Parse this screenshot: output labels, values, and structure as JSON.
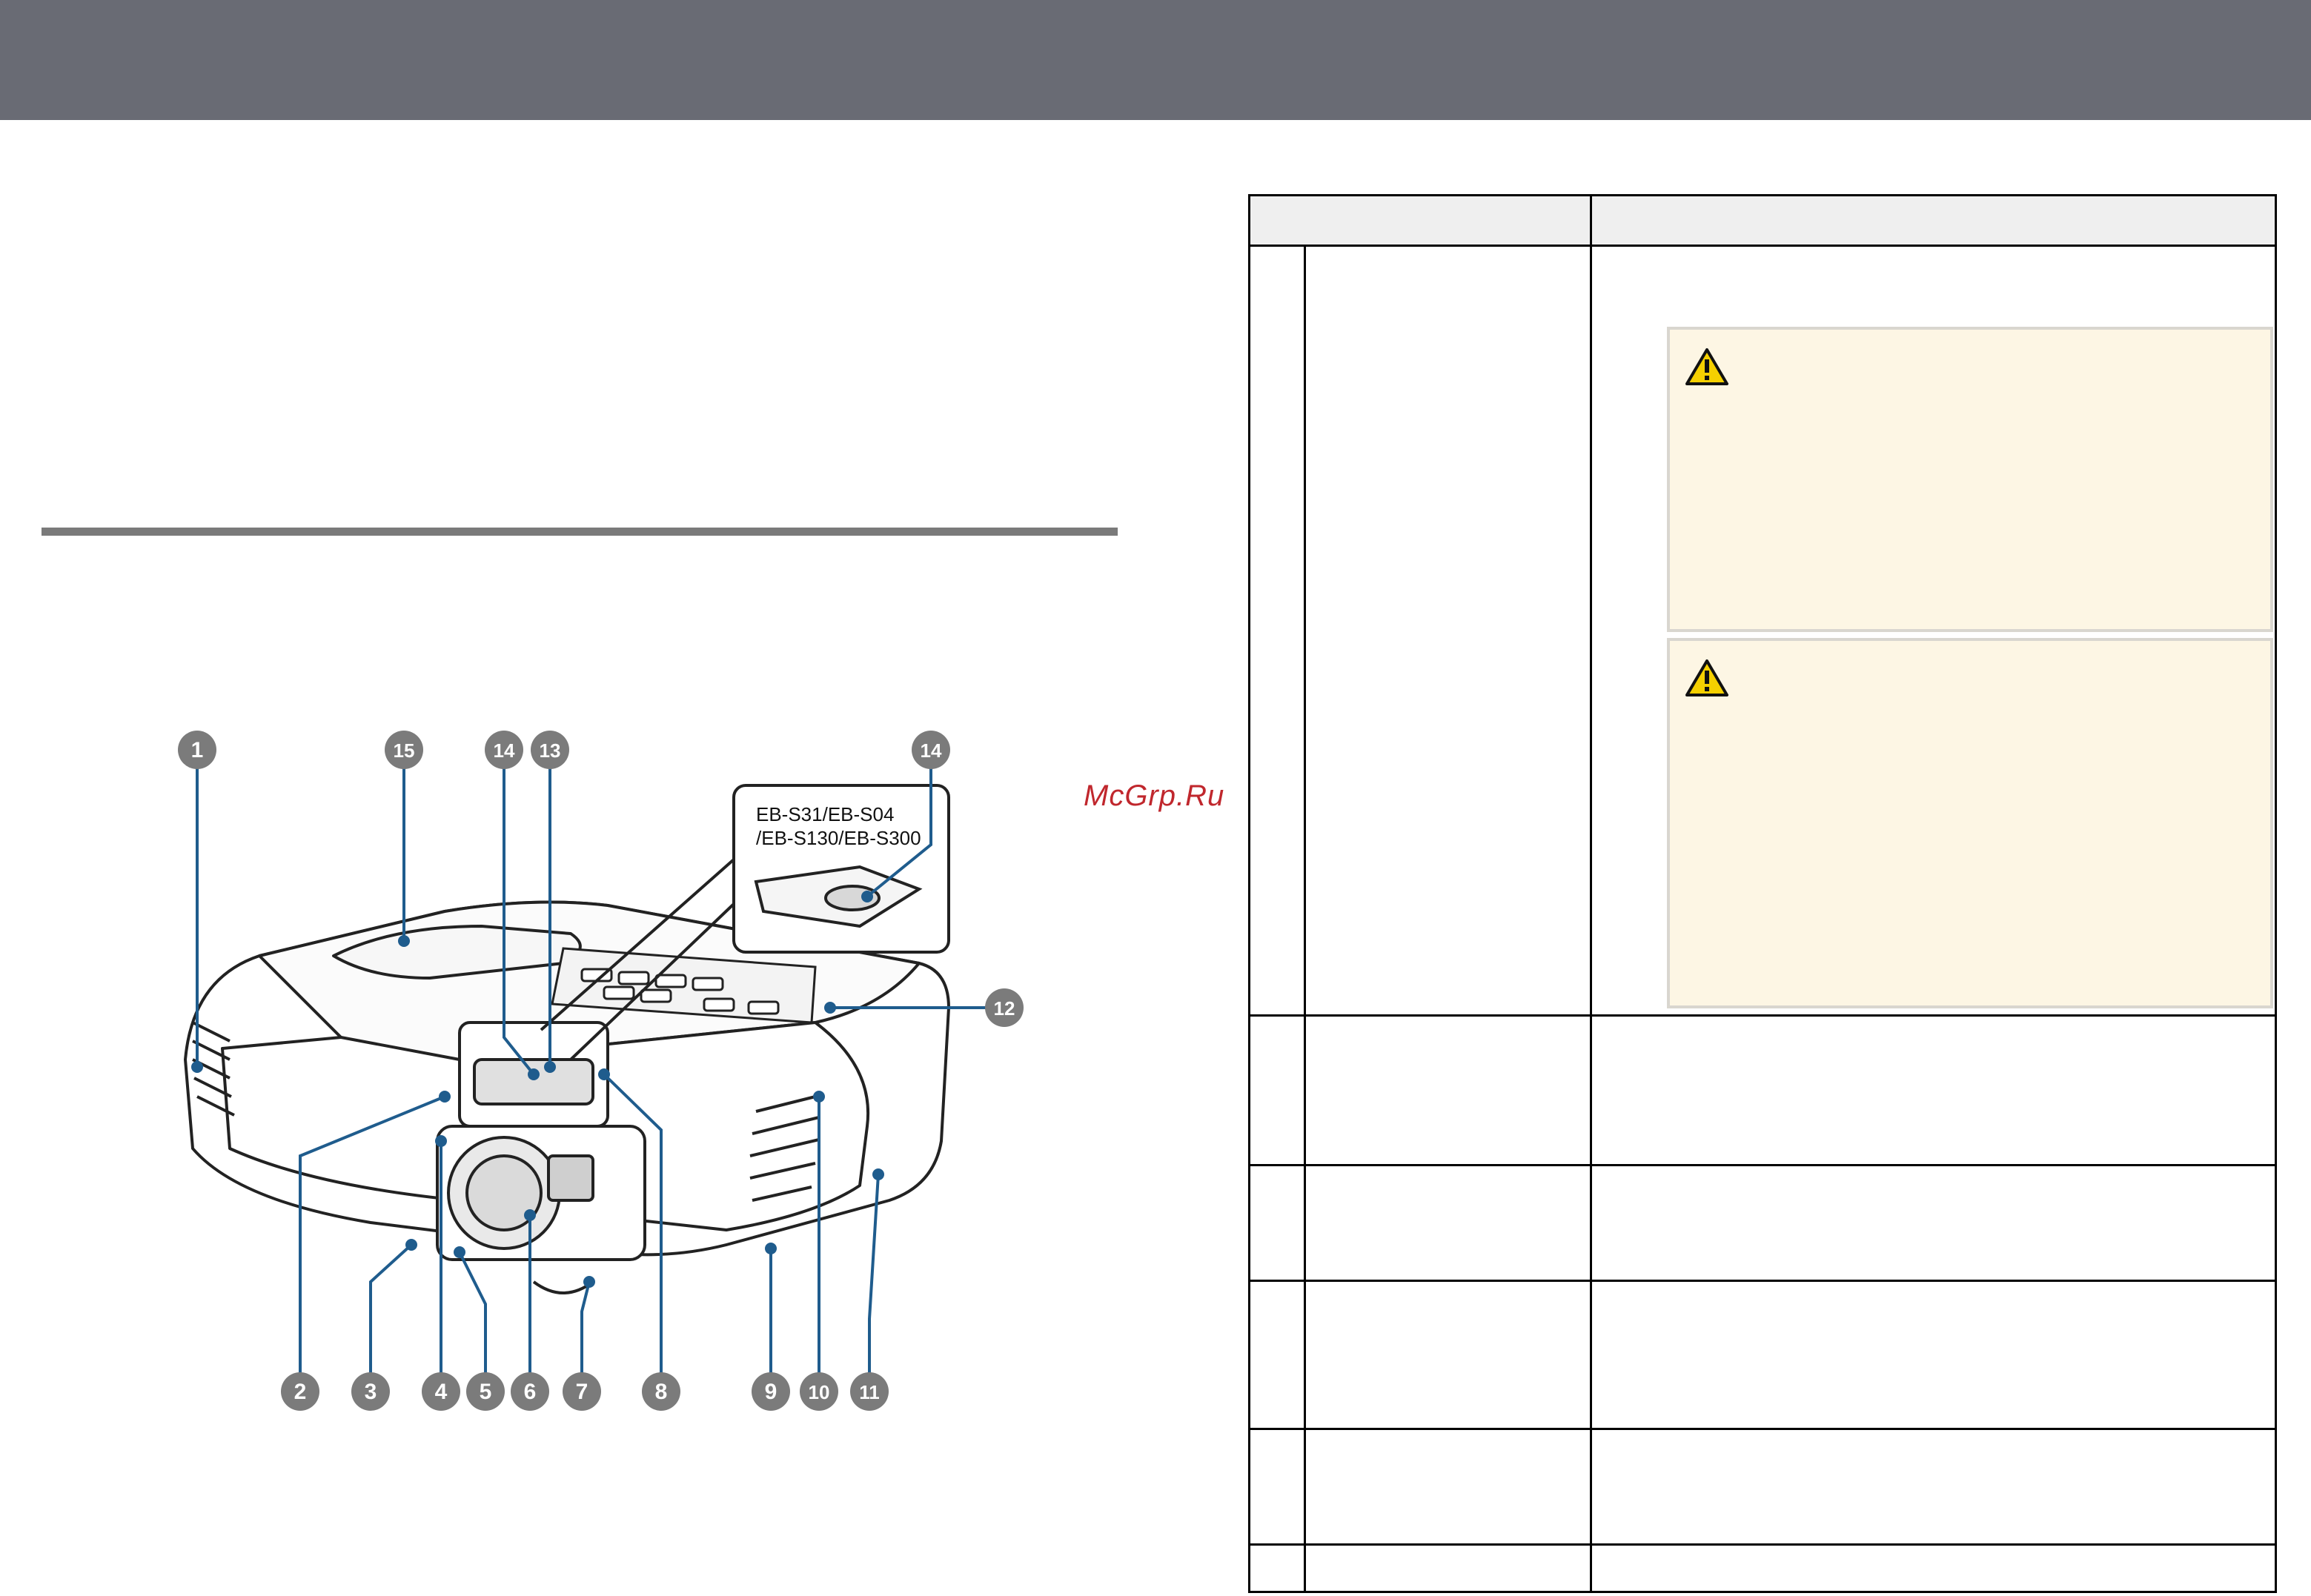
{
  "watermark": "McGrp.Ru",
  "figure": {
    "inset_label_line1": "EB-S31/EB-S04",
    "inset_label_line2": "/EB-S130/EB-S300",
    "callouts": [
      "1",
      "2",
      "3",
      "4",
      "5",
      "6",
      "7",
      "8",
      "9",
      "10",
      "11",
      "12",
      "13",
      "14",
      "14",
      "15"
    ]
  },
  "table": {
    "rows": 6,
    "cautions": [
      "warning-icon",
      "warning-icon"
    ]
  },
  "colors": {
    "header_bar": "#696b74",
    "callout_fill": "#7b7b7b",
    "leader_line": "#1f5c8d",
    "caution_bg": "#fdf6e4",
    "watermark": "#c0272d"
  }
}
